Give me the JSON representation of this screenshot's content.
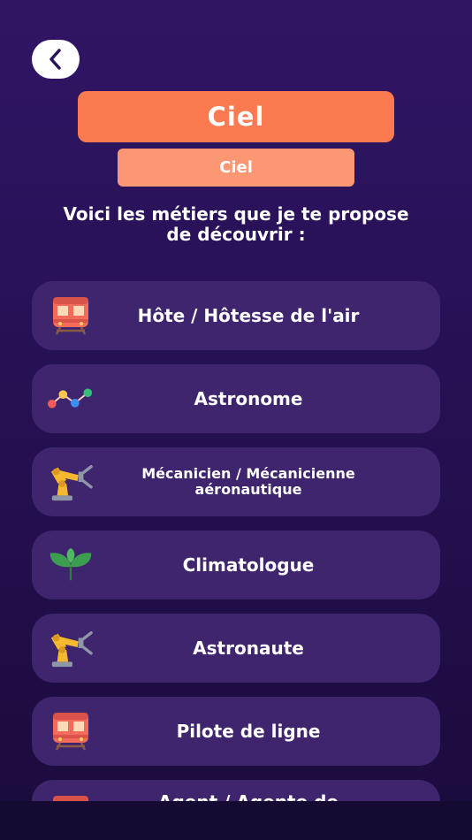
{
  "header": {
    "title": "Ciel",
    "subtitle": "Ciel"
  },
  "intro_text": "Voici les métiers que je te propose de découvrir :",
  "careers": [
    {
      "label": "Hôte / Hôtesse de l'air",
      "icon": "train-icon"
    },
    {
      "label": "Astronome",
      "icon": "chart-line-icon"
    },
    {
      "label": "Mécanicien / Mécanicienne aéronautique",
      "icon": "robot-arm-icon"
    },
    {
      "label": "Climatologue",
      "icon": "leaves-icon"
    },
    {
      "label": "Astronaute",
      "icon": "robot-arm-icon"
    },
    {
      "label": "Pilote de ligne",
      "icon": "train-icon"
    },
    {
      "label": "Agent / Agente de",
      "icon": "train-icon"
    }
  ],
  "colors": {
    "background": "#2a1359",
    "card": "#3f246e",
    "accent": "#fc7a4f",
    "accent_light": "#fc9773"
  }
}
